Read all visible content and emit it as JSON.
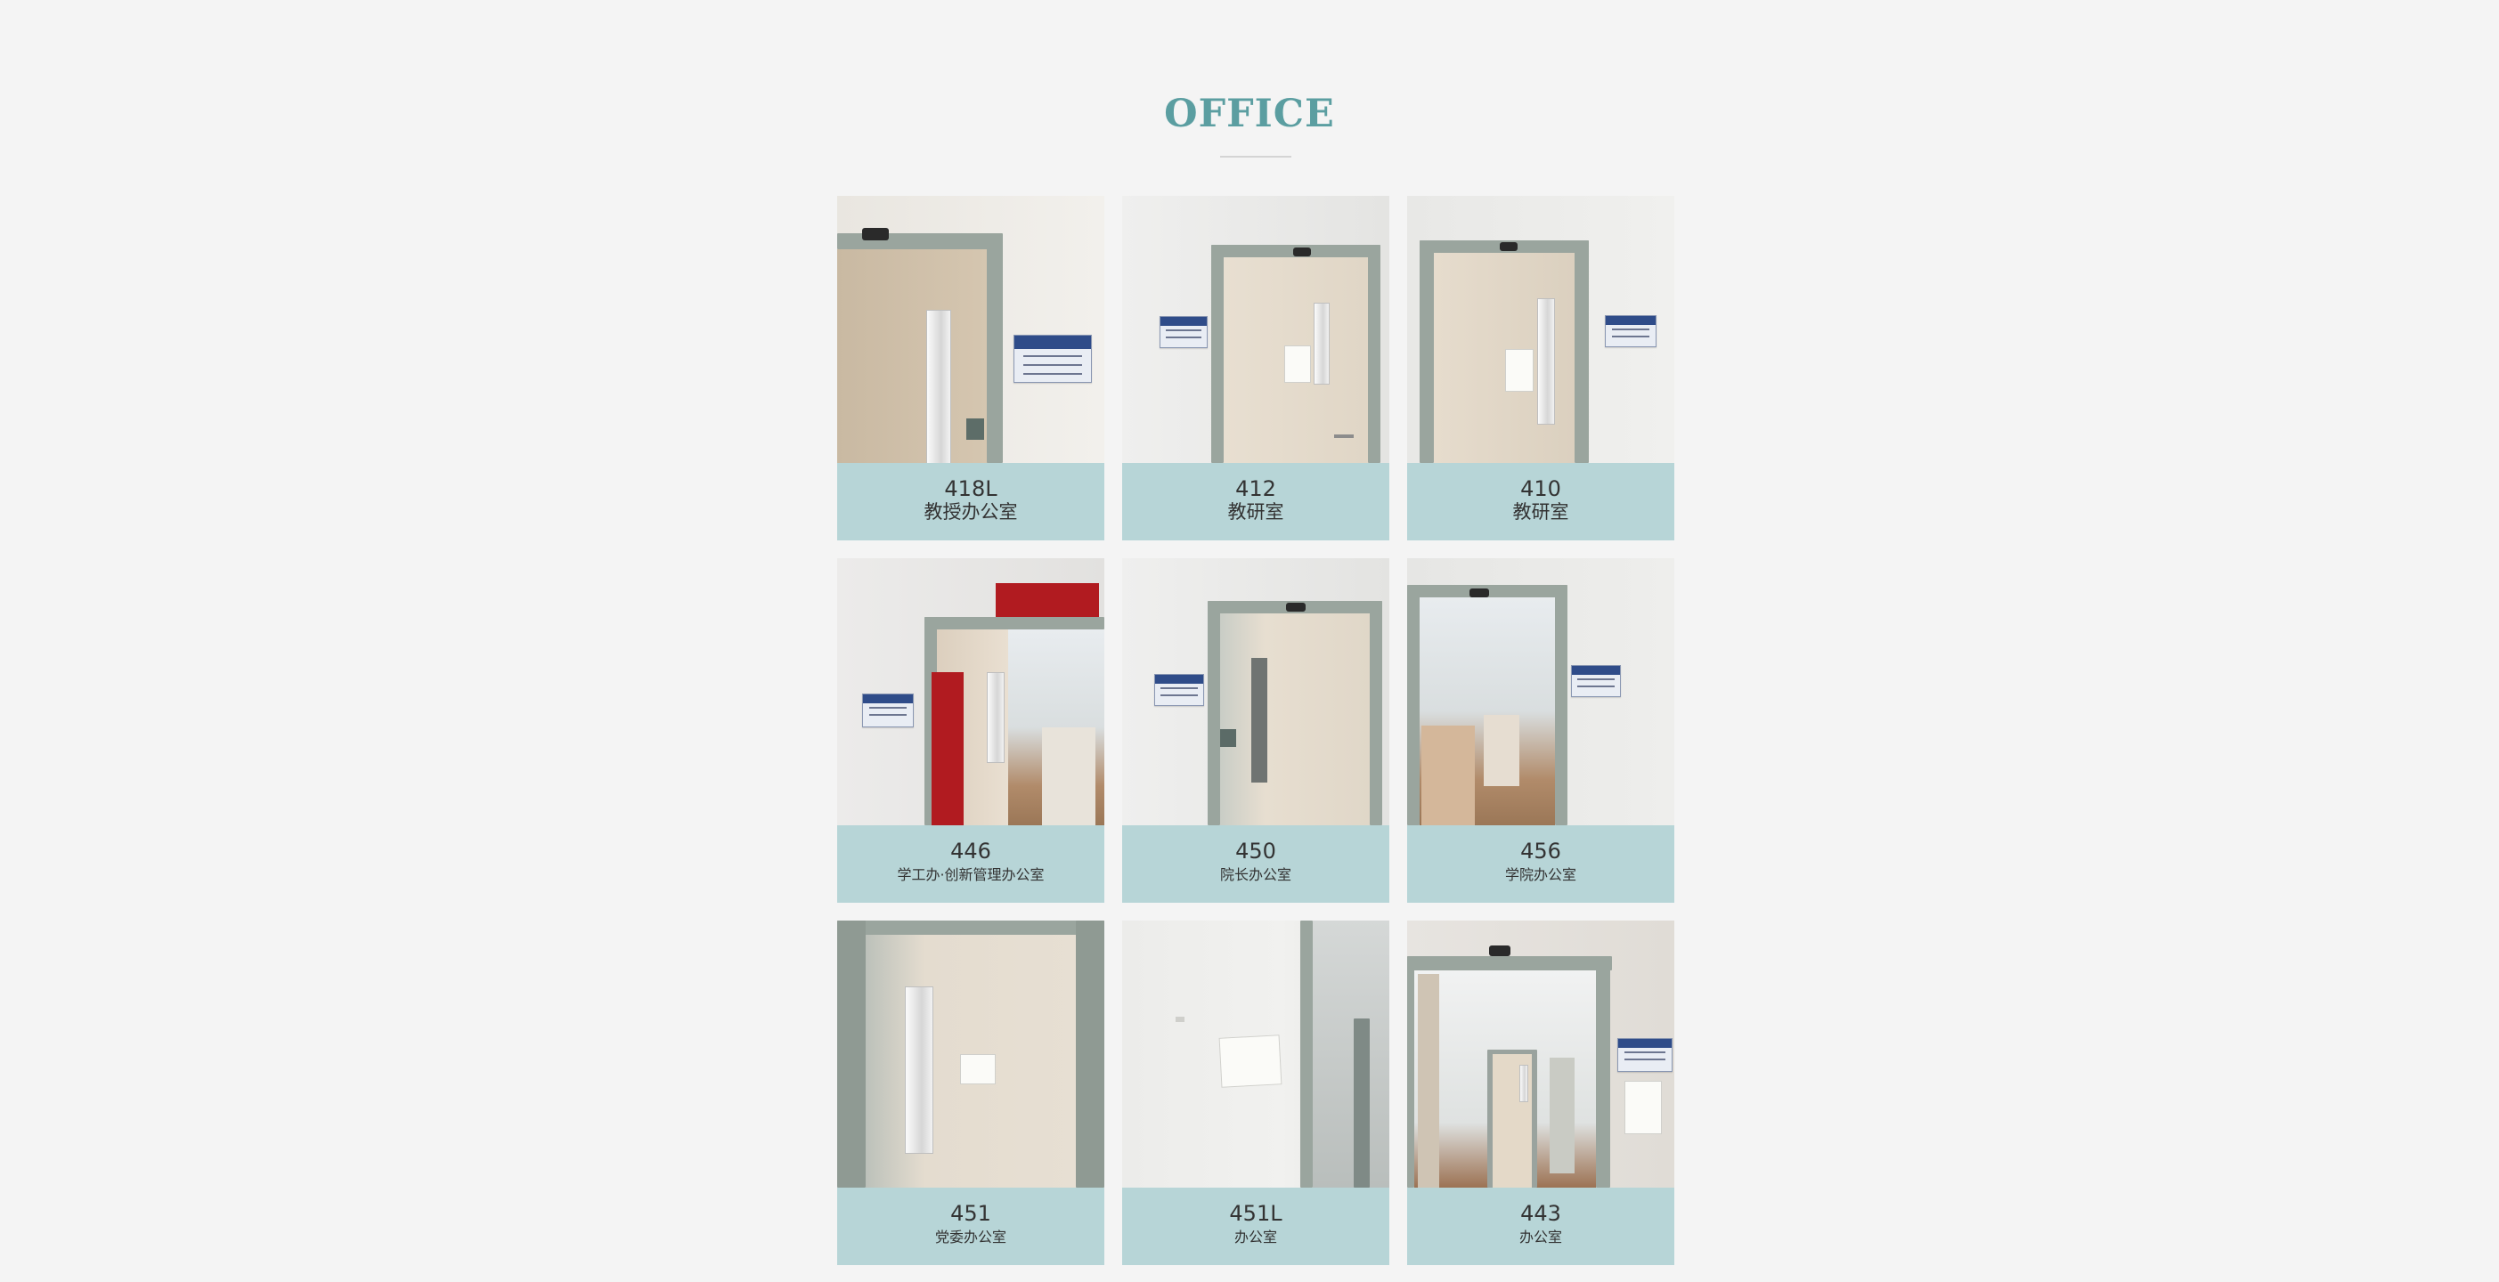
{
  "page": {
    "title": "OFFICE"
  },
  "offices": [
    {
      "number": "418L",
      "name": "教授办公室"
    },
    {
      "number": "412",
      "name": "教研室"
    },
    {
      "number": "410",
      "name": "教研室"
    },
    {
      "number": "446",
      "name": "学工办·创新管理办公室"
    },
    {
      "number": "450",
      "name": "院长办公室"
    },
    {
      "number": "456",
      "name": "学院办公室"
    },
    {
      "number": "451",
      "name": "党委办公室"
    },
    {
      "number": "451L",
      "name": "办公室"
    },
    {
      "number": "443",
      "name": "办公室"
    }
  ]
}
